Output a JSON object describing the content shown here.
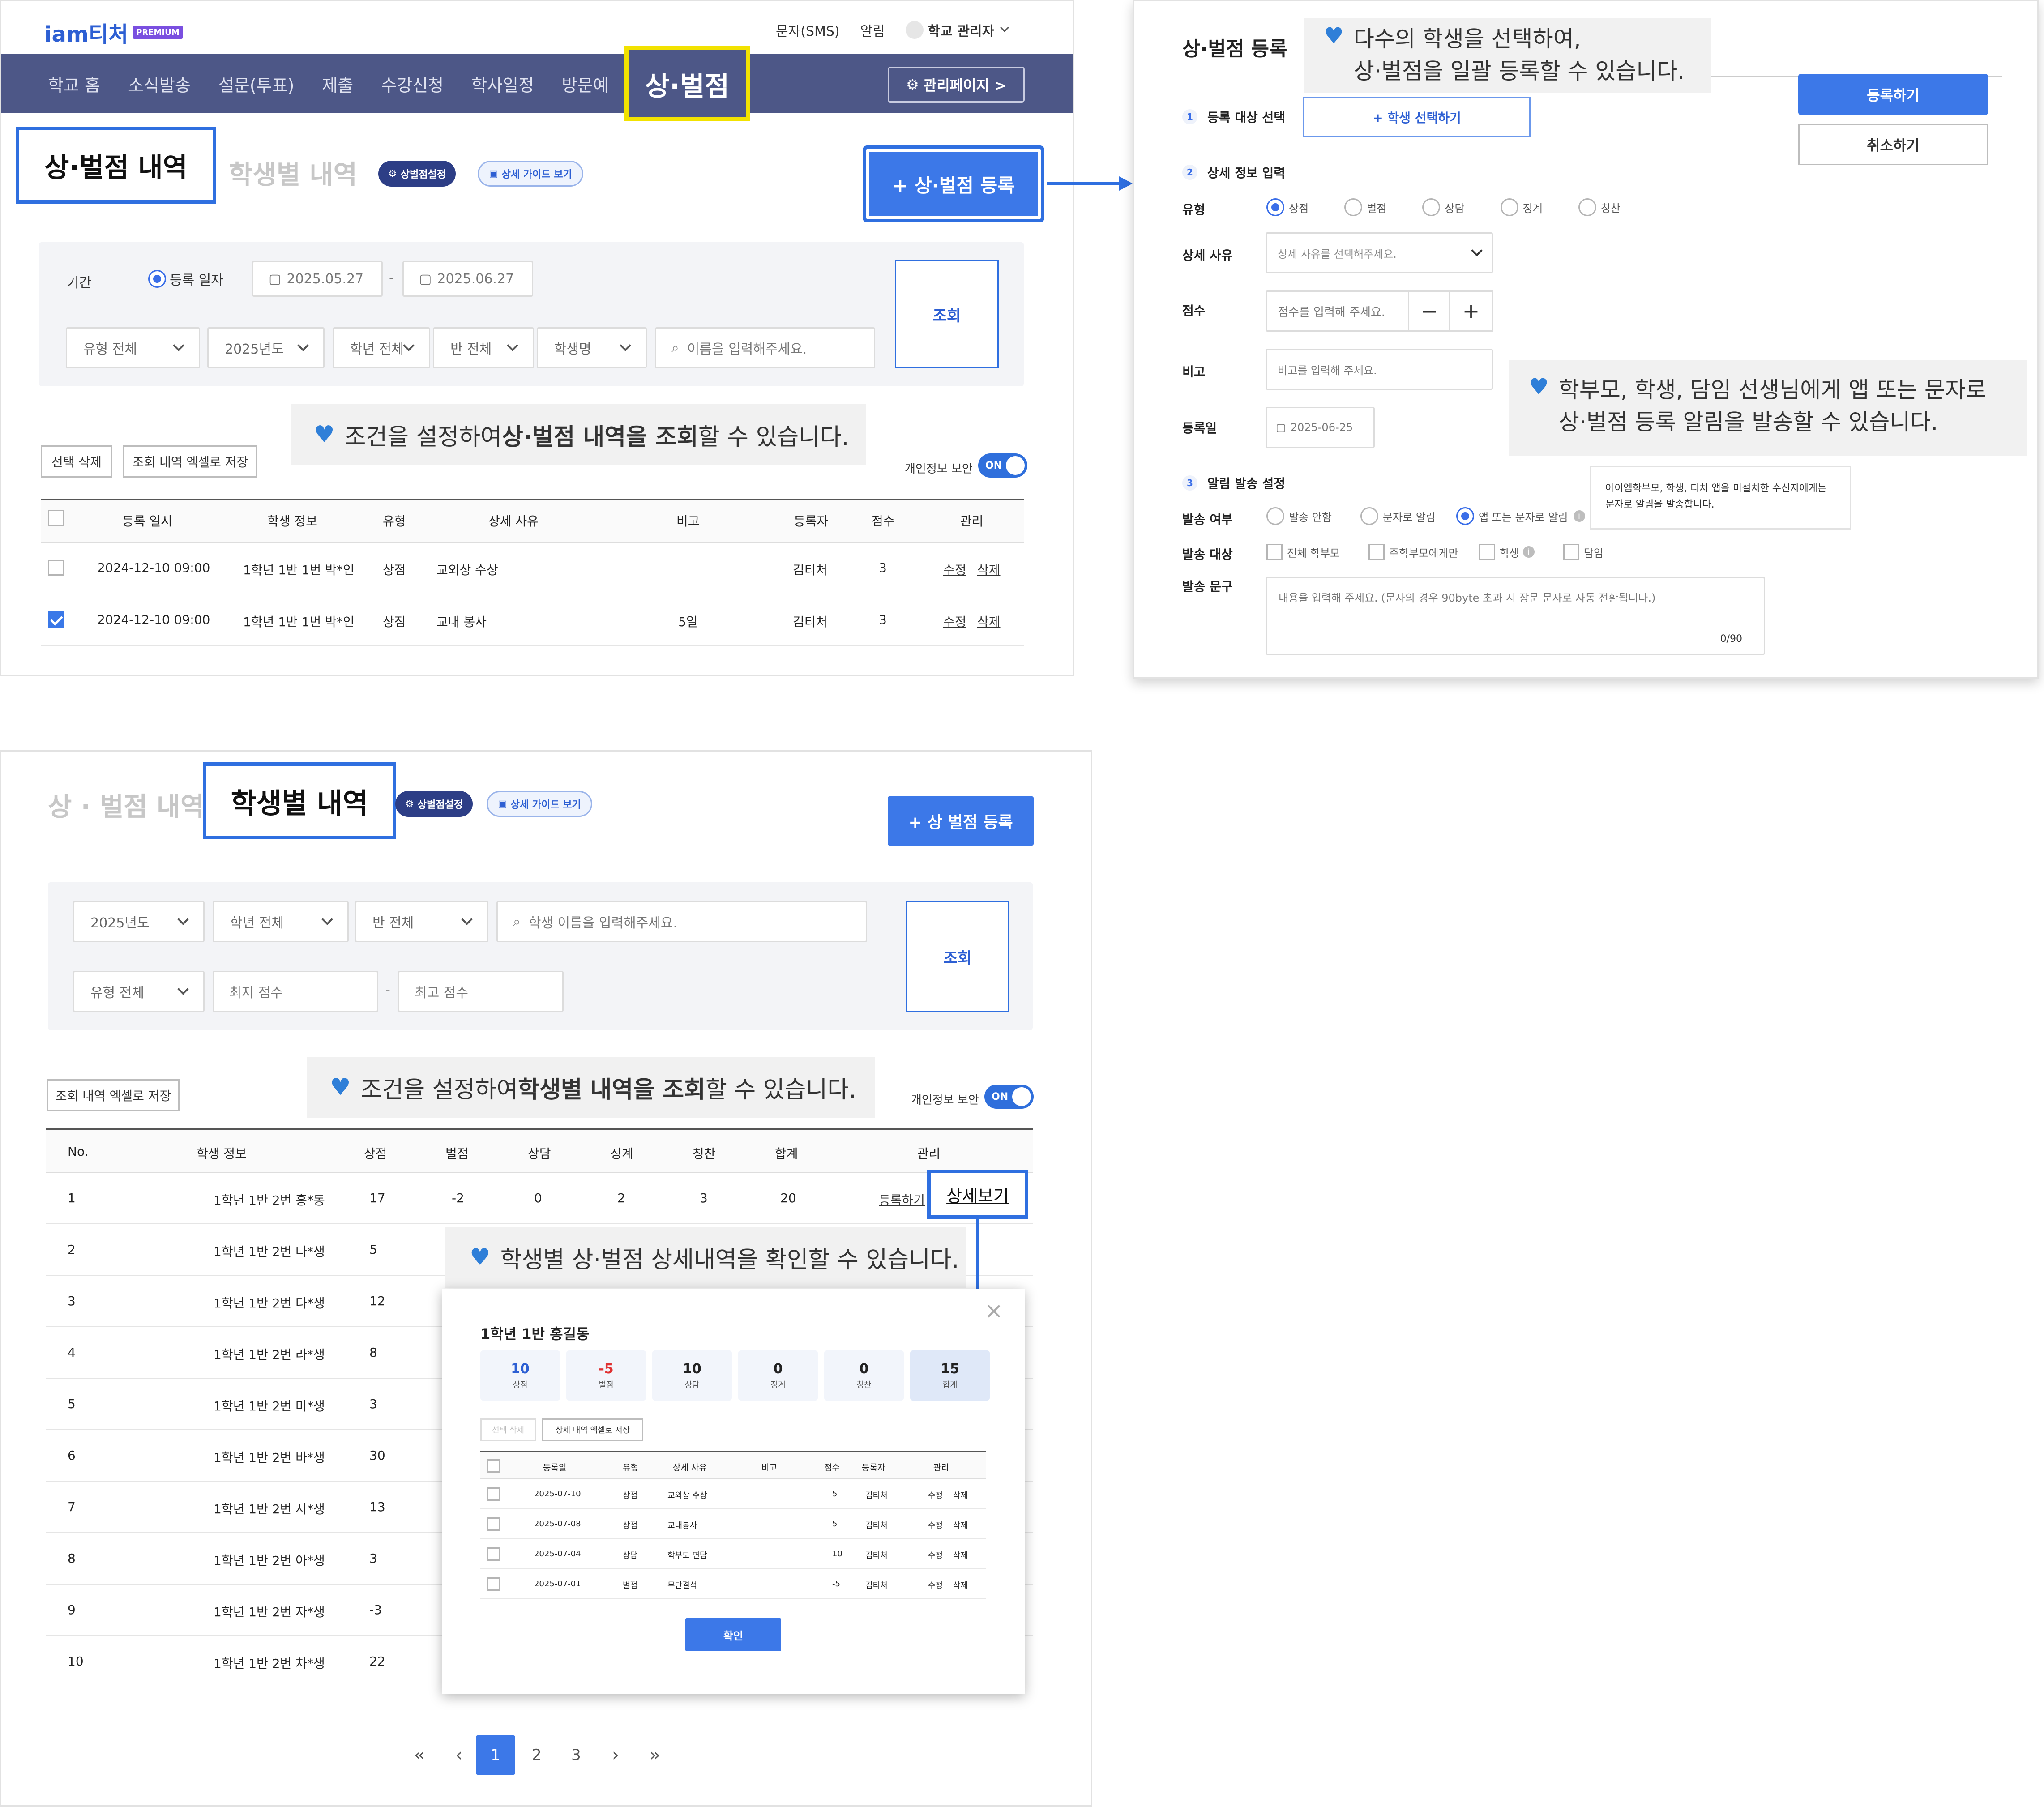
{
  "app": {
    "logo": "iam티처",
    "premium": "PREMIUM",
    "top_links": [
      "문자(SMS)",
      "알림"
    ],
    "admin_user": "학교 관리자"
  },
  "nav": {
    "items": [
      "학교 홈",
      "소식발송",
      "설문(투표)",
      "제출",
      "수강신청",
      "학사일정",
      "방문예"
    ],
    "active": "상·벌점",
    "admin_page": "관리페이지 >"
  },
  "list": {
    "title": "상·벌점 내역",
    "tab_other": "학생별 내역",
    "badge_settings": "상벌점설정",
    "badge_guide": "상세 가이드 보기",
    "register_btn": "+ 상·벌점 등록",
    "filter": {
      "period_label": "기간",
      "radio_label": "등록 일자",
      "date_from": "2025.05.27",
      "date_sep": "-",
      "date_to": "2025.06.27",
      "type": "유형 전체",
      "year": "2025년도",
      "grade": "학년 전체",
      "class": "반 전체",
      "student": "학생명",
      "search_placeholder": "이름을 입력해주세요.",
      "search_btn": "조회"
    },
    "callout": {
      "pre": "조건을 설정하여 ",
      "bold": "상·벌점 내역을 조회",
      "post": "할 수 있습니다."
    },
    "actions": {
      "delete": "선택 삭제",
      "excel": "조회 내역 엑셀로 저장"
    },
    "privacy": {
      "label": "개인정보 보안",
      "toggle": "ON"
    },
    "headers": [
      "등록 일시",
      "학생 정보",
      "유형",
      "상세 사유",
      "비고",
      "등록자",
      "점수",
      "관리"
    ],
    "rows": [
      {
        "date": "2024-12-10 09:00",
        "student": "1학년 1반 1번 박*인",
        "type": "상점",
        "reason": "교외상 수상",
        "note": "",
        "by": "김티처",
        "score": "3",
        "edit": "수정",
        "del": "삭제",
        "checked": false
      },
      {
        "date": "2024-12-10 09:00",
        "student": "1학년 1반 1번 박*인",
        "type": "상점",
        "reason": "교내 봉사",
        "note": "5일",
        "by": "김티처",
        "score": "3",
        "edit": "수정",
        "del": "삭제",
        "checked": true
      }
    ]
  },
  "reg": {
    "title": "상·벌점 등록",
    "callout1": {
      "line1": "다수의 학생을 선택하여,",
      "line2": "상·벌점을 일괄 등록할 수 있습니다."
    },
    "submit": "등록하기",
    "cancel": "취소하기",
    "step1": {
      "num": "1",
      "label": "등록 대상 선택",
      "btn": "+ 학생 선택하기"
    },
    "step2": {
      "num": "2",
      "label": "상세 정보 입력"
    },
    "type_label": "유형",
    "types": [
      "상점",
      "벌점",
      "상담",
      "징계",
      "칭찬"
    ],
    "reason_label": "상세 사유",
    "reason_placeholder": "상세 사유를 선택해주세요.",
    "score_label": "점수",
    "score_placeholder": "점수를 입력해 주세요.",
    "minus": "−",
    "plus": "+",
    "note_label": "비고",
    "note_placeholder": "비고를 입력해 주세요.",
    "date_label": "등록일",
    "date_value": "2025-06-25",
    "callout2": {
      "line1": "학부모, 학생, 담임 선생님에게 앱 또는 문자로",
      "line2": "상·벌점 등록 알림을 발송할 수 있습니다."
    },
    "step3": {
      "num": "3",
      "label": "알림 발송 설정"
    },
    "tooltip": {
      "line1": "아이엠학부모, 학생, 티처 앱을 미설치한 수신자에게는",
      "line2": "문자로 알림을 발송합니다."
    },
    "send_label": "발송 여부",
    "send_opts": [
      "발송 안함",
      "문자로 알림",
      "앱 또는 문자로 알림"
    ],
    "target_label": "발송 대상",
    "targets": [
      "전체 학부모",
      "주학부모에게만",
      "학생",
      "담임"
    ],
    "msg_label": "발송 문구",
    "msg_placeholder": "내용을 입력해 주세요. (문자의 경우 90byte 초과 시 장문 문자로 자동 전환됩니다.)",
    "msg_count": "0/90"
  },
  "students": {
    "tab_other": "상 · 벌점 내역",
    "title": "학생별 내역",
    "badge_settings": "상벌점설정",
    "badge_guide": "상세 가이드 보기",
    "register_btn": "+ 상 벌점 등록",
    "filter": {
      "year": "2025년도",
      "grade": "학년 전체",
      "class": "반 전체",
      "search_placeholder": "학생 이름을 입력해주세요.",
      "type": "유형 전체",
      "min": "최저 점수",
      "sep": "-",
      "max": "최고 점수",
      "search_btn": "조회"
    },
    "callout": {
      "pre": "조건을 설정하여 ",
      "bold": "학생별 내역을 조회",
      "post": "할 수 있습니다."
    },
    "excel": "조회 내역 엑셀로 저장",
    "privacy": {
      "label": "개인정보 보안",
      "toggle": "ON"
    },
    "headers": [
      "No.",
      "학생 정보",
      "상점",
      "벌점",
      "상담",
      "징계",
      "칭찬",
      "합계",
      "관리"
    ],
    "rows": [
      {
        "no": "1",
        "student": "1학년 1반 2번 홍*동",
        "plus": "17",
        "minus": "-2",
        "counsel": "0",
        "discipline": "2",
        "praise": "3",
        "total": "20"
      },
      {
        "no": "2",
        "student": "1학년 1반 2번 나*생",
        "plus": "5"
      },
      {
        "no": "3",
        "student": "1학년 1반 2번 다*생",
        "plus": "12"
      },
      {
        "no": "4",
        "student": "1학년 1반 2번 라*생",
        "plus": "8"
      },
      {
        "no": "5",
        "student": "1학년 1반 2번 마*생",
        "plus": "3"
      },
      {
        "no": "6",
        "student": "1학년 1반 2번 바*생",
        "plus": "30"
      },
      {
        "no": "7",
        "student": "1학년 1반 2번 사*생",
        "plus": "13"
      },
      {
        "no": "8",
        "student": "1학년 1반 2번 아*생",
        "plus": "3"
      },
      {
        "no": "9",
        "student": "1학년 1반 2번 자*생",
        "plus": "-3"
      },
      {
        "no": "10",
        "student": "1학년 1반 2번 차*생",
        "plus": "22"
      }
    ],
    "row_register": "등록하기",
    "row_detail": "상세보기",
    "callout_detail": "학생별 상·벌점 상세내역을 확인할 수 있습니다.",
    "pagination": {
      "first": "«",
      "prev": "‹",
      "pages": [
        "1",
        "2",
        "3"
      ],
      "next": "›",
      "last": "»"
    }
  },
  "modal": {
    "title": "1학년 1반 홍길동",
    "stats": [
      {
        "v": "10",
        "l": "상점"
      },
      {
        "v": "-5",
        "l": "벌점"
      },
      {
        "v": "10",
        "l": "상담"
      },
      {
        "v": "0",
        "l": "징계"
      },
      {
        "v": "0",
        "l": "칭찬"
      },
      {
        "v": "15",
        "l": "합계"
      }
    ],
    "actions": {
      "delete": "선택 삭제",
      "excel": "상세 내역 엑셀로 저장"
    },
    "headers": [
      "등록일",
      "유형",
      "상세 사유",
      "비고",
      "점수",
      "등록자",
      "관리"
    ],
    "rows": [
      {
        "date": "2025-07-10",
        "type": "상점",
        "reason": "교외상 수상",
        "note": "",
        "score": "5",
        "by": "김티처"
      },
      {
        "date": "2025-07-08",
        "type": "상점",
        "reason": "교내봉사",
        "note": "",
        "score": "5",
        "by": "김티처"
      },
      {
        "date": "2025-07-04",
        "type": "상담",
        "reason": "학부모 면담",
        "note": "",
        "score": "10",
        "by": "김티처"
      },
      {
        "date": "2025-07-01",
        "type": "벌점",
        "reason": "무단결석",
        "note": "",
        "score": "-5",
        "by": "김티처"
      }
    ],
    "edit": "수정",
    "del": "삭제",
    "confirm": "확인",
    "close": "×"
  },
  "colors": {
    "nav_bg": "#4d5787",
    "accent": "#3c78e8",
    "highlight_yellow": "#f2e200",
    "negative": "#e03131"
  }
}
